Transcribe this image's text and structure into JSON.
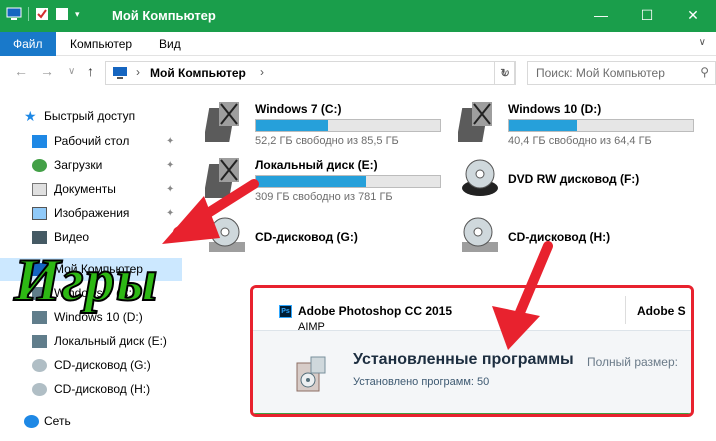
{
  "window": {
    "title": "Мой Компьютер",
    "controls": [
      "minimize-icon",
      "maximize-icon",
      "close-icon"
    ],
    "accent": "#1a9e4b"
  },
  "ribbon": {
    "tabs": [
      {
        "label": "Файл"
      },
      {
        "label": "Компьютер"
      },
      {
        "label": "Вид"
      }
    ],
    "file_color": "#1979ca"
  },
  "address": {
    "crumb": "Мой Компьютер",
    "search_placeholder": "Поиск: Мой Компьютер"
  },
  "sidebar": {
    "items": [
      {
        "label": "Быстрый доступ",
        "icon": "star-icon",
        "pinned": false
      },
      {
        "label": "Рабочий стол",
        "icon": "desktop-icon",
        "pinned": true
      },
      {
        "label": "Загрузки",
        "icon": "download-icon",
        "pinned": true
      },
      {
        "label": "Документы",
        "icon": "document-icon",
        "pinned": true
      },
      {
        "label": "Изображения",
        "icon": "image-icon",
        "pinned": true
      },
      {
        "label": "Видео",
        "icon": "video-icon",
        "pinned": false
      },
      {
        "label": "Мой Компьютер",
        "icon": "computer-icon",
        "pinned": false
      },
      {
        "label": "Windows 7 (C:)",
        "icon": "drive-icon",
        "pinned": false
      },
      {
        "label": "Windows 10 (D:)",
        "icon": "drive-icon",
        "pinned": false
      },
      {
        "label": "Локальный диск (E:)",
        "icon": "drive-icon",
        "pinned": false
      },
      {
        "label": "CD-дисковод (G:)",
        "icon": "cd-drive-icon",
        "pinned": false
      },
      {
        "label": "CD-дисковод (H:)",
        "icon": "cd-drive-icon",
        "pinned": false
      },
      {
        "label": "Сеть",
        "icon": "network-icon",
        "pinned": false
      }
    ]
  },
  "drives": [
    {
      "name": "Windows 7 (C:)",
      "free": "52,2 ГБ свободно из 85,5 ГБ",
      "used_fraction": 0.39,
      "icon": "hard-drive-icon"
    },
    {
      "name": "Windows 10 (D:)",
      "free": "40,4 ГБ свободно из 64,4 ГБ",
      "used_fraction": 0.37,
      "icon": "hard-drive-icon"
    },
    {
      "name": "Локальный диск (E:)",
      "free": "309 ГБ свободно из 781 ГБ",
      "used_fraction": 0.6,
      "icon": "hard-drive-icon"
    },
    {
      "name": "DVD RW дисковод (F:)",
      "icon": "dvd-drive-icon"
    },
    {
      "name": "CD-дисковод (G:)",
      "icon": "cd-drive-icon"
    },
    {
      "name": "CD-дисковод (H:)",
      "icon": "cd-drive-icon"
    }
  ],
  "overlay": {
    "label": "Игры",
    "label_color": "#2db814",
    "arrow_color": "#e8222e"
  },
  "inset": {
    "app_name": "Adobe Photoshop CC 2015",
    "app_icon_text": "Ps",
    "next_app": "Adobe S",
    "partial_app": "AIMP",
    "title": "Установленные программы",
    "size_label": "Полный размер:",
    "count_text": "Установлено программ: 50"
  }
}
